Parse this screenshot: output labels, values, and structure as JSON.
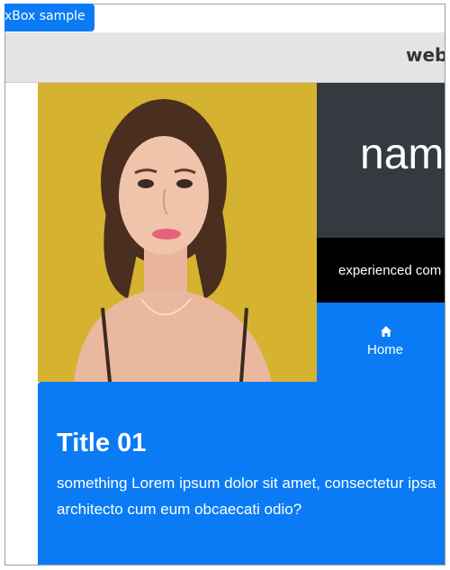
{
  "window": {
    "tab_label": "xBox sample"
  },
  "header": {
    "brand": "web"
  },
  "profile": {
    "name": "nam",
    "tagline": "experienced com"
  },
  "nav": {
    "home": {
      "label": "Home",
      "icon": "home-icon"
    }
  },
  "card": {
    "title": "Title 01",
    "body": "something Lorem ipsum dolor sit amet, consectetur ipsa architecto cum eum obcaecati odio?"
  },
  "colors": {
    "accent": "#0a7bf5",
    "dark": "#343a40",
    "black": "#000000",
    "photo_bg": "#d7b431",
    "topbar": "#e4e4e4"
  }
}
